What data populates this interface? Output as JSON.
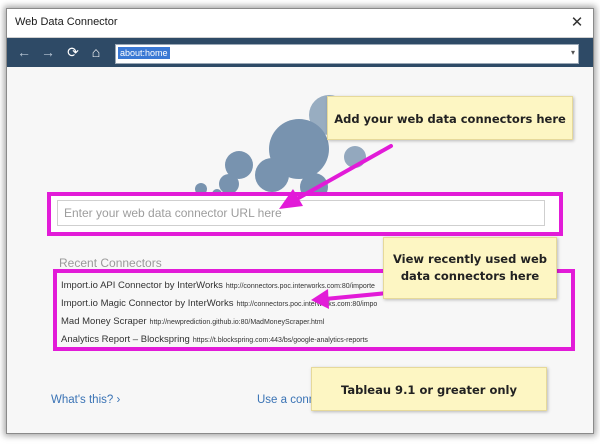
{
  "window": {
    "title": "Web Data Connector",
    "close_symbol": "✕"
  },
  "navbar": {
    "back_symbol": "←",
    "forward_symbol": "→",
    "refresh_symbol": "⟳",
    "home_symbol": "⌂",
    "address_value": "about:home",
    "dropdown_symbol": "▾"
  },
  "main": {
    "url_placeholder": "Enter your web data connector URL here",
    "recent_title": "Recent Connectors",
    "recent": [
      {
        "name": "Import.io API Connector by InterWorks",
        "url": "http://connectors.poc.interworks.com:80/importe"
      },
      {
        "name": "Import.io Magic Connector by InterWorks",
        "url": "http://connectors.poc.interworks.com:80/impo"
      },
      {
        "name": "Mad Money Scraper",
        "url": "http://newprediction.github.io:80/MadMoneyScraper.html"
      },
      {
        "name": "Analytics Report – Blockspring",
        "url": "https://t.blockspring.com:443/bs/google-analytics-reports"
      }
    ],
    "whats_this": "What's this? ›",
    "use_connector": "Use a conn"
  },
  "callouts": {
    "add": "Add your web data connectors here",
    "recent_line1": "View recently used web",
    "recent_line2": "data connectors here",
    "version": "Tableau 9.1 or greater only"
  },
  "colors": {
    "highlight": "#e21bd8",
    "navbar": "#2e4a66",
    "callout": "#fdf6c3",
    "link": "#3a73b5"
  }
}
